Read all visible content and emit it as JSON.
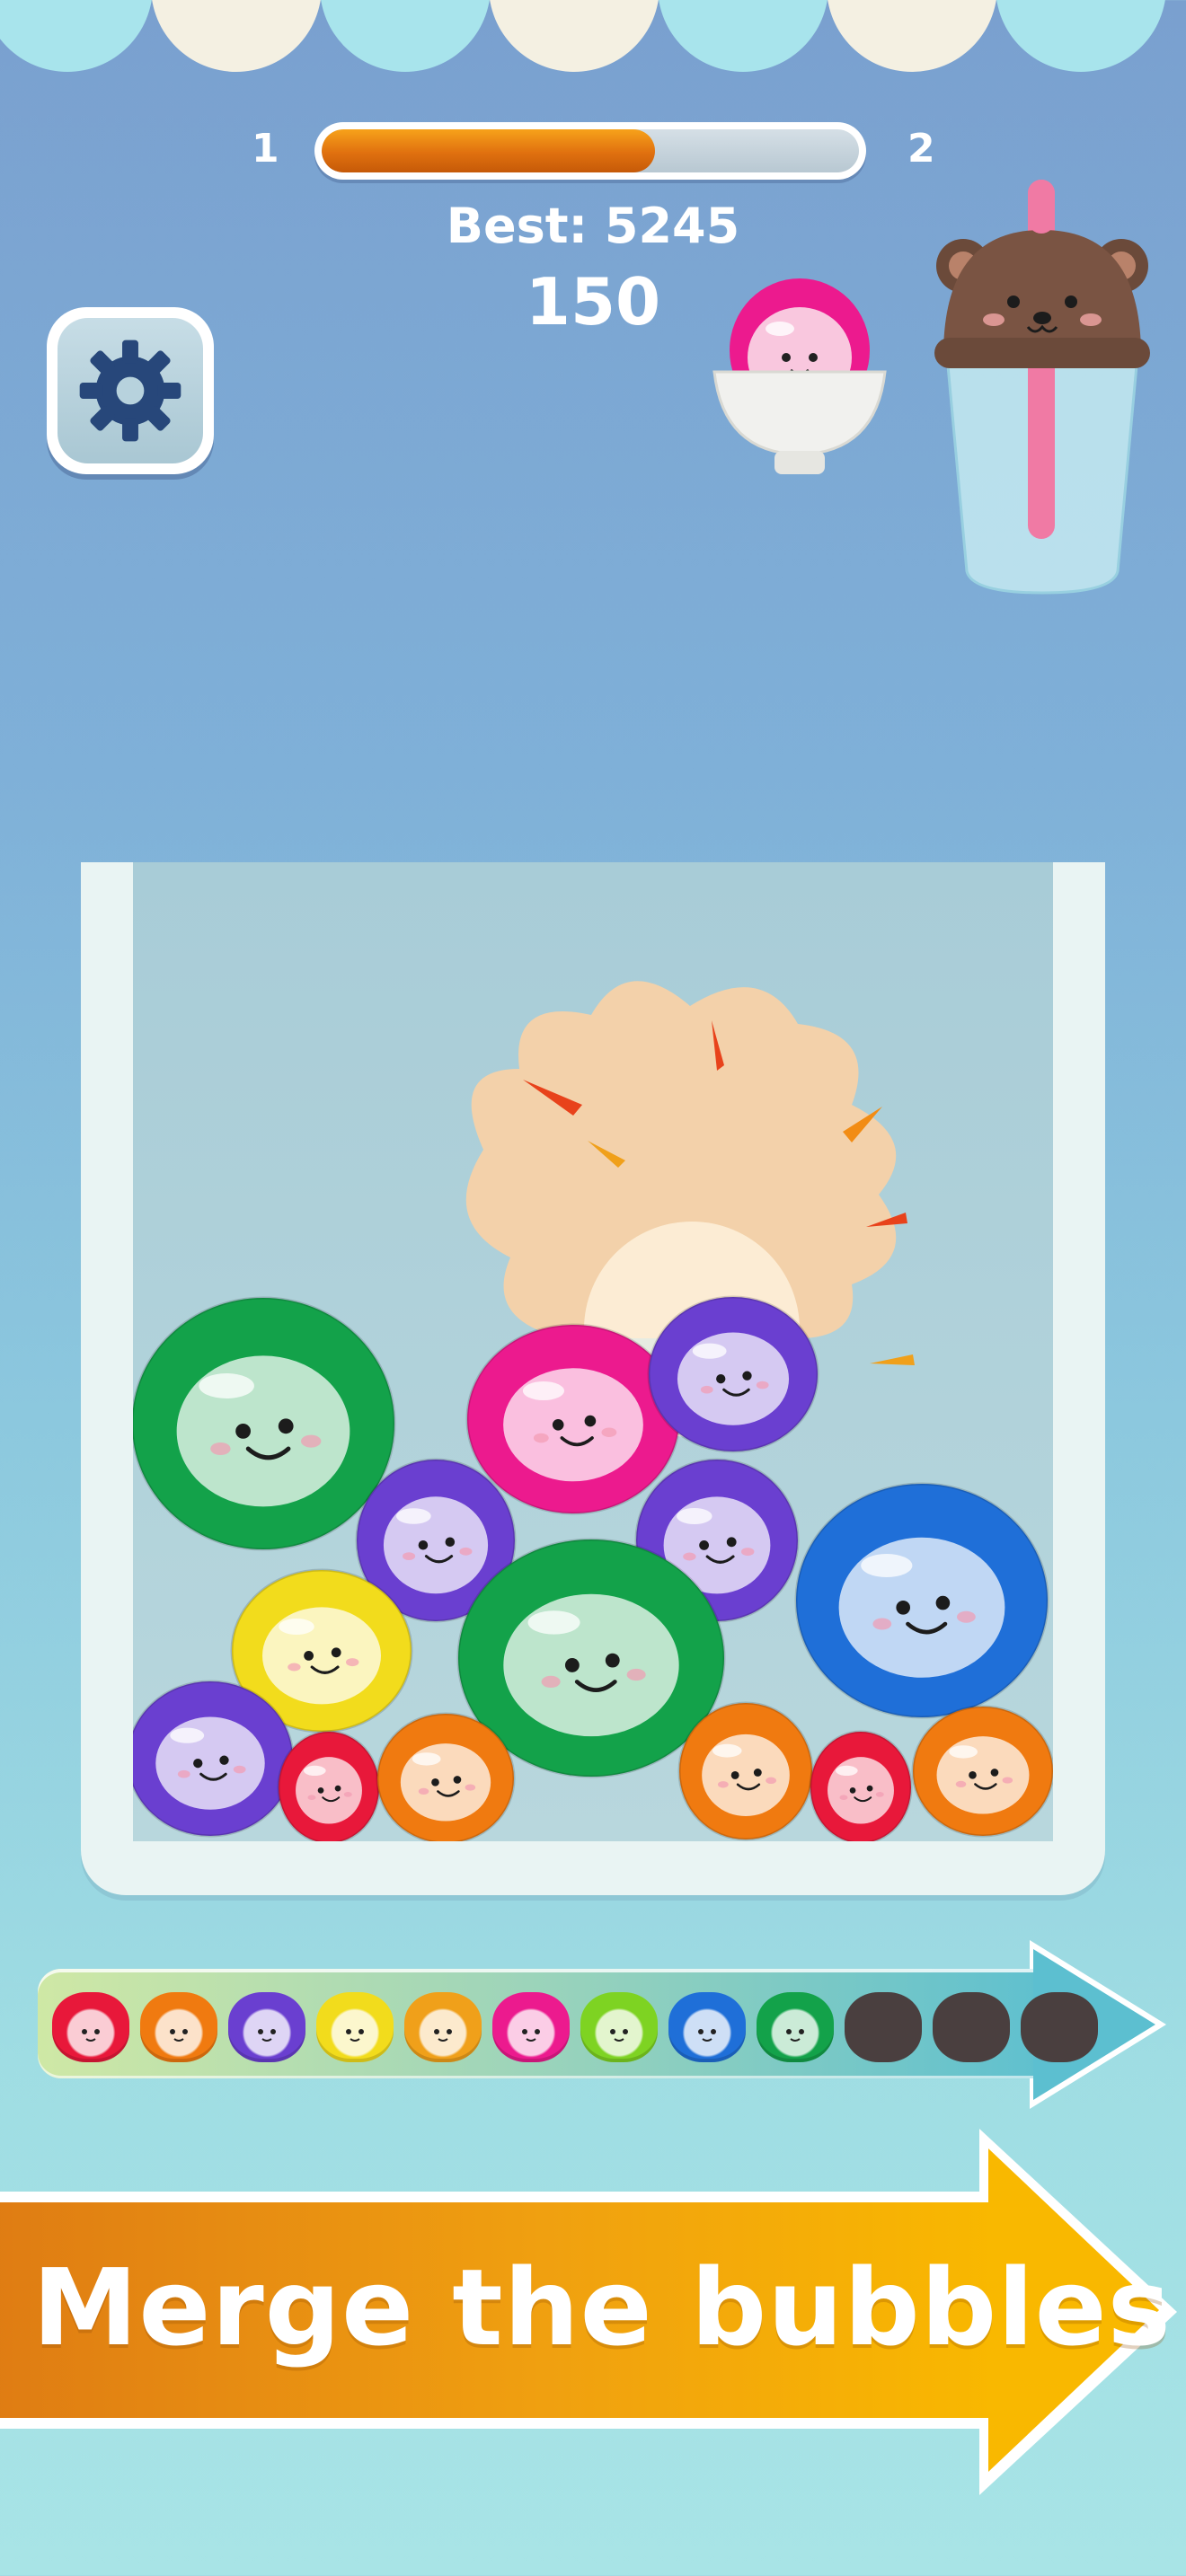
{
  "level": {
    "current": "1",
    "next": "2",
    "progress": 0.62
  },
  "stats": {
    "best_label": "Best: 5245",
    "score": "150"
  },
  "icons": {
    "settings": "gear-icon",
    "cup": "bear-cup-icon",
    "next_bubble": "pink-bubble-in-bowl-icon"
  },
  "colors": {
    "red": "#e8183a",
    "orange": "#f07a10",
    "purple": "#6a3fd0",
    "yellow": "#f2dc1c",
    "amber": "#f0a01a",
    "pink": "#ec1a8e",
    "lime": "#7ed322",
    "blue": "#1f6fd8",
    "green": "#13a24a",
    "locked": "#4a3f3f",
    "scallop_cream": "#f4f0e2",
    "scallop_blue": "#a8e4ec"
  },
  "progression": [
    {
      "color": "red",
      "locked": false
    },
    {
      "color": "orange",
      "locked": false
    },
    {
      "color": "purple",
      "locked": false
    },
    {
      "color": "yellow",
      "locked": false
    },
    {
      "color": "amber",
      "locked": false
    },
    {
      "color": "pink",
      "locked": false
    },
    {
      "color": "lime",
      "locked": false
    },
    {
      "color": "blue",
      "locked": false
    },
    {
      "color": "green",
      "locked": false
    },
    {
      "color": "locked",
      "locked": true
    },
    {
      "color": "locked",
      "locked": true
    },
    {
      "color": "locked",
      "locked": true
    }
  ],
  "bubbles": [
    {
      "color": "green"
    },
    {
      "color": "pink"
    },
    {
      "color": "purple"
    },
    {
      "color": "purple"
    },
    {
      "color": "purple"
    },
    {
      "color": "yellow"
    },
    {
      "color": "green"
    },
    {
      "color": "blue"
    },
    {
      "color": "purple"
    },
    {
      "color": "red"
    },
    {
      "color": "orange"
    },
    {
      "color": "orange"
    },
    {
      "color": "red"
    },
    {
      "color": "orange"
    }
  ],
  "banner": {
    "text": "Merge the bubbles!"
  }
}
